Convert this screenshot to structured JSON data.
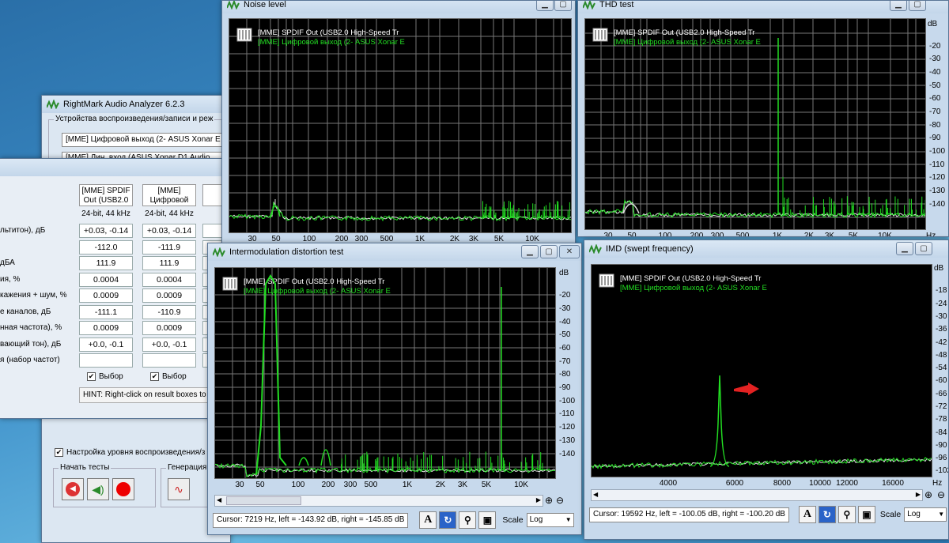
{
  "windows": {
    "noise": {
      "title": "Noise level",
      "legend1": "[MME] SPDIF Out (USB2.0 High-Speed Tr",
      "legend2": "[MME] Цифровой выход (2- ASUS Xonar E",
      "xticks": [
        "30",
        "50",
        "100",
        "200",
        "300",
        "500",
        "1K",
        "2K",
        "3K",
        "5K",
        "10K"
      ]
    },
    "thd": {
      "title": "THD test",
      "legend1": "[MME] SPDIF Out (USB2.0 High-Speed Tr",
      "legend2": "[MME] Цифровой выход (2- ASUS Xonar E",
      "db": "dB",
      "yticks": [
        "-20",
        "-30",
        "-40",
        "-50",
        "-60",
        "-70",
        "-80",
        "-90",
        "-100",
        "-110",
        "-120",
        "-130",
        "-140"
      ],
      "xticks": [
        "30",
        "50",
        "100",
        "200",
        "300",
        "500",
        "1K",
        "2K",
        "3K",
        "5K",
        "10K"
      ],
      "hz": "Hz"
    },
    "imd": {
      "title": "Intermodulation distortion test",
      "legend1": "[MME] SPDIF Out (USB2.0 High-Speed Tr",
      "legend2": "[MME] Цифровой выход (2- ASUS Xonar E",
      "db": "dB",
      "yticks": [
        "-20",
        "-30",
        "-40",
        "-50",
        "-60",
        "-70",
        "-80",
        "-90",
        "-100",
        "-110",
        "-120",
        "-130",
        "-140"
      ],
      "xticks": [
        "30",
        "50",
        "100",
        "200",
        "300",
        "500",
        "1K",
        "2K",
        "3K",
        "5K",
        "10K"
      ],
      "cursor": "Cursor:  7219 Hz,  left = -143.92 dB,  right = -145.85 dB",
      "scale_label": "Scale",
      "scale_value": "Log"
    },
    "imdswept": {
      "title": "IMD (swept frequency)",
      "legend1": "[MME] SPDIF Out (USB2.0 High-Speed Tr",
      "legend2": "[MME] Цифровой выход (2- ASUS Xonar E",
      "db": "dB",
      "yticks": [
        "-18",
        "-24",
        "-30",
        "-36",
        "-42",
        "-48",
        "-54",
        "-60",
        "-66",
        "-72",
        "-78",
        "-84",
        "-90",
        "-96",
        "-102"
      ],
      "xticks": [
        "4000",
        "6000",
        "8000",
        "10000",
        "12000",
        "16000"
      ],
      "hz": "Hz",
      "cursor": "Cursor:  19592 Hz,  left = -100.05 dB,  right = -100.20 dB",
      "scale_label": "Scale",
      "scale_value": "Log"
    },
    "rmaa": {
      "title": "RightMark Audio Analyzer 6.2.3",
      "devices_label": "Устройства воспроизведения/записи и реж",
      "device1": "[MME] Цифровой выход (2- ASUS Xonar E",
      "device2": "[MME] Лин. вход (ASUS Xonar D1 Audio",
      "level_check": "Настройка уровня воспроизведения/з",
      "start_tests": "Начать тесты",
      "generation": "Генерация"
    }
  },
  "results": {
    "headers": [
      [
        "[MME] SPDIF",
        "Out (USB2.0"
      ],
      [
        "[MME]",
        "Цифровой"
      ]
    ],
    "formats": [
      "24-bit, 44 kHz",
      "24-bit, 44 kHz"
    ],
    "rows": [
      {
        "label": "льтитон), дБ",
        "v1": "+0.03, -0.14",
        "v2": "+0.03, -0.14"
      },
      {
        "label": "",
        "v1": "-112.0",
        "v2": "-111.9"
      },
      {
        "label": "дБА",
        "v1": "111.9",
        "v2": "111.9"
      },
      {
        "label": "ия, %",
        "v1": "0.0004",
        "v2": "0.0004"
      },
      {
        "label": "кажения + шум, %",
        "v1": "0.0009",
        "v2": "0.0009"
      },
      {
        "label": "е каналов, дБ",
        "v1": "-111.1",
        "v2": "-110.9"
      },
      {
        "label": "нная частота), %",
        "v1": "0.0009",
        "v2": "0.0009"
      },
      {
        "label": "вающий тон), дБ",
        "v1": "+0.0, -0.1",
        "v2": "+0.0, -0.1"
      },
      {
        "label": "я (набор частот)",
        "v1": "",
        "v2": ""
      }
    ],
    "select": "Выбор",
    "hint": "HINT: Right-click on result boxes to"
  }
}
